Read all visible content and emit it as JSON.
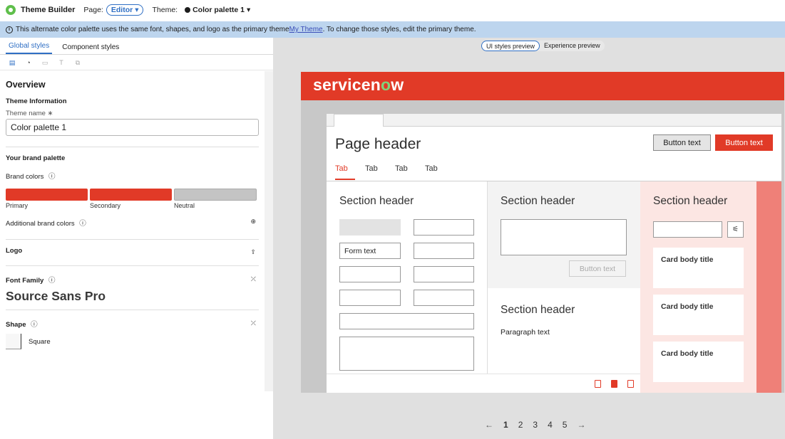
{
  "topbar": {
    "app_title": "Theme Builder",
    "page_label": "Page:",
    "page_value": "Editor",
    "theme_label": "Theme:",
    "theme_value": "Color palette 1"
  },
  "banner": {
    "text_before": "This alternate color palette uses the same font, shapes, and logo as the primary theme ",
    "link": "My Theme",
    "text_after": ". To change those styles, edit the primary theme."
  },
  "left": {
    "tabs": [
      "Global styles",
      "Component styles"
    ],
    "overview": "Overview",
    "theme_info": "Theme Information",
    "theme_name_label": "Theme name ∗",
    "theme_name_value": "Color palette 1",
    "brand_palette": "Your brand palette",
    "brand_colors": "Brand colors",
    "swatches": [
      {
        "label": "Primary",
        "color": "#e13a27"
      },
      {
        "label": "Secondary",
        "color": "#e13a27"
      },
      {
        "label": "Neutral",
        "color": "#c4c4c4"
      }
    ],
    "additional_colors": "Additional brand colors",
    "logo": "Logo",
    "font_family": "Font Family",
    "font_name": "Source Sans Pro",
    "shape": "Shape",
    "shape_name": "Square"
  },
  "preview": {
    "toggle": [
      "UI styles preview",
      "Experience preview"
    ],
    "logo_text_a": "servicen",
    "logo_text_o": "o",
    "logo_text_b": "w",
    "page_header": "Page header",
    "button_secondary": "Button text",
    "button_primary": "Button text",
    "tabs": [
      "Tab",
      "Tab",
      "Tab",
      "Tab"
    ],
    "section_header_1": "Section header",
    "section_header_2": "Section header",
    "section_header_3": "Section header",
    "section_header_4": "Section header",
    "form_text": "Form text",
    "button_disabled": "Button text",
    "paragraph": "Paragraph text",
    "card_titles": [
      "Card body title",
      "Card body title",
      "Card body title"
    ],
    "pager": [
      "1",
      "2",
      "3",
      "4",
      "5"
    ]
  }
}
